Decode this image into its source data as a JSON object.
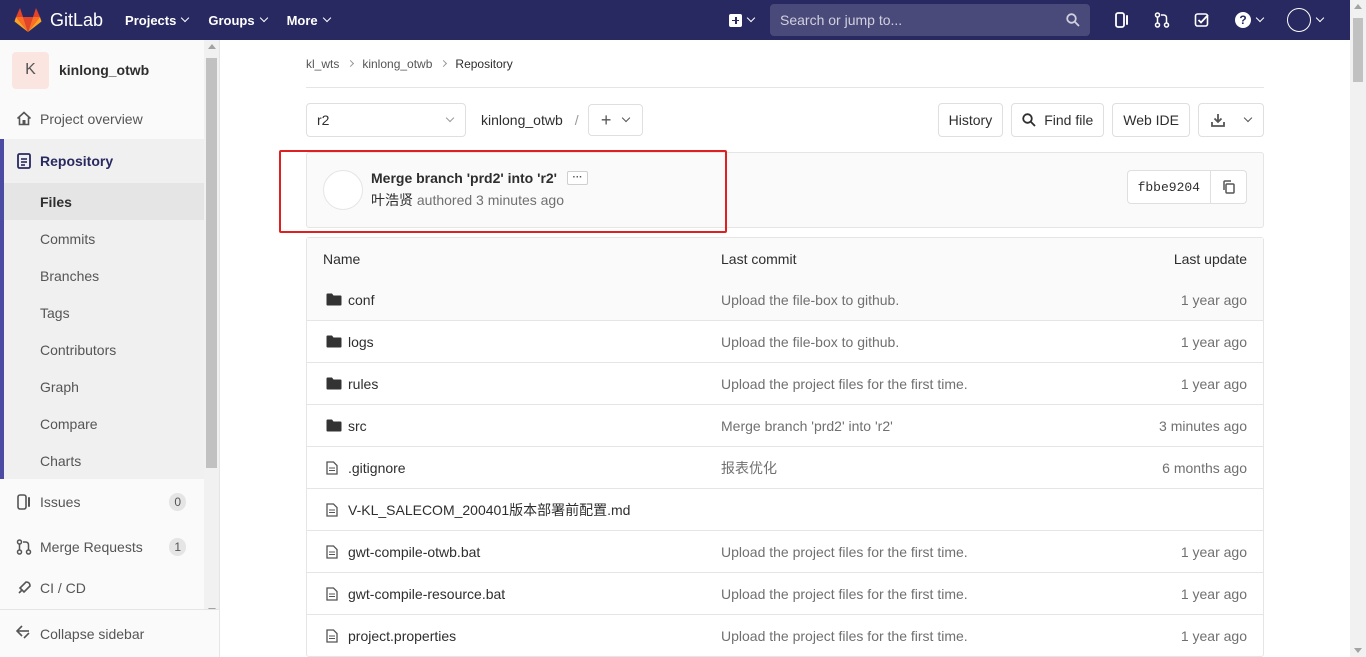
{
  "navbar": {
    "brand": "GitLab",
    "menu": [
      {
        "label": "Projects"
      },
      {
        "label": "Groups"
      },
      {
        "label": "More"
      }
    ],
    "search_placeholder": "Search or jump to...",
    "bg_color": "#292961"
  },
  "sidebar": {
    "project_avatar_letter": "K",
    "project_name": "kinlong_otwb",
    "overview": "Project overview",
    "repository": "Repository",
    "repo_items": [
      "Files",
      "Commits",
      "Branches",
      "Tags",
      "Contributors",
      "Graph",
      "Compare",
      "Charts"
    ],
    "issues": "Issues",
    "issues_count": "0",
    "merge_requests": "Merge Requests",
    "mr_count": "1",
    "cicd": "CI / CD",
    "collapse": "Collapse sidebar"
  },
  "breadcrumb": [
    "kl_wts",
    "kinlong_otwb",
    "Repository"
  ],
  "toolbar": {
    "branch": "r2",
    "path": "kinlong_otwb",
    "slash": "/",
    "history": "History",
    "find_file": "Find file",
    "web_ide": "Web IDE"
  },
  "commit": {
    "title": "Merge branch 'prd2' into 'r2'",
    "ellipsis": "···",
    "author": "叶浩贤",
    "authored": "authored 3 minutes ago",
    "sha": "fbbe9204"
  },
  "table": {
    "headers": {
      "name": "Name",
      "last_commit": "Last commit",
      "last_update": "Last update"
    },
    "rows": [
      {
        "type": "folder",
        "name": "conf",
        "commit": "Upload the file-box to github.",
        "updated": "1 year ago"
      },
      {
        "type": "folder",
        "name": "logs",
        "commit": "Upload the file-box to github.",
        "updated": "1 year ago"
      },
      {
        "type": "folder",
        "name": "rules",
        "commit": "Upload the project files for the first time.",
        "updated": "1 year ago"
      },
      {
        "type": "folder",
        "name": "src",
        "commit": "Merge branch 'prd2' into 'r2'",
        "updated": "3 minutes ago"
      },
      {
        "type": "file",
        "name": ".gitignore",
        "commit": "报表优化",
        "updated": "6 months ago"
      },
      {
        "type": "file",
        "name": "V-KL_SALECOM_200401版本部署前配置.md",
        "commit": "",
        "updated": ""
      },
      {
        "type": "file",
        "name": "gwt-compile-otwb.bat",
        "commit": "Upload the project files for the first time.",
        "updated": "1 year ago"
      },
      {
        "type": "file",
        "name": "gwt-compile-resource.bat",
        "commit": "Upload the project files for the first time.",
        "updated": "1 year ago"
      },
      {
        "type": "file",
        "name": "project.properties",
        "commit": "Upload the project files for the first time.",
        "updated": "1 year ago"
      }
    ]
  },
  "highlight_color": "#e02020"
}
